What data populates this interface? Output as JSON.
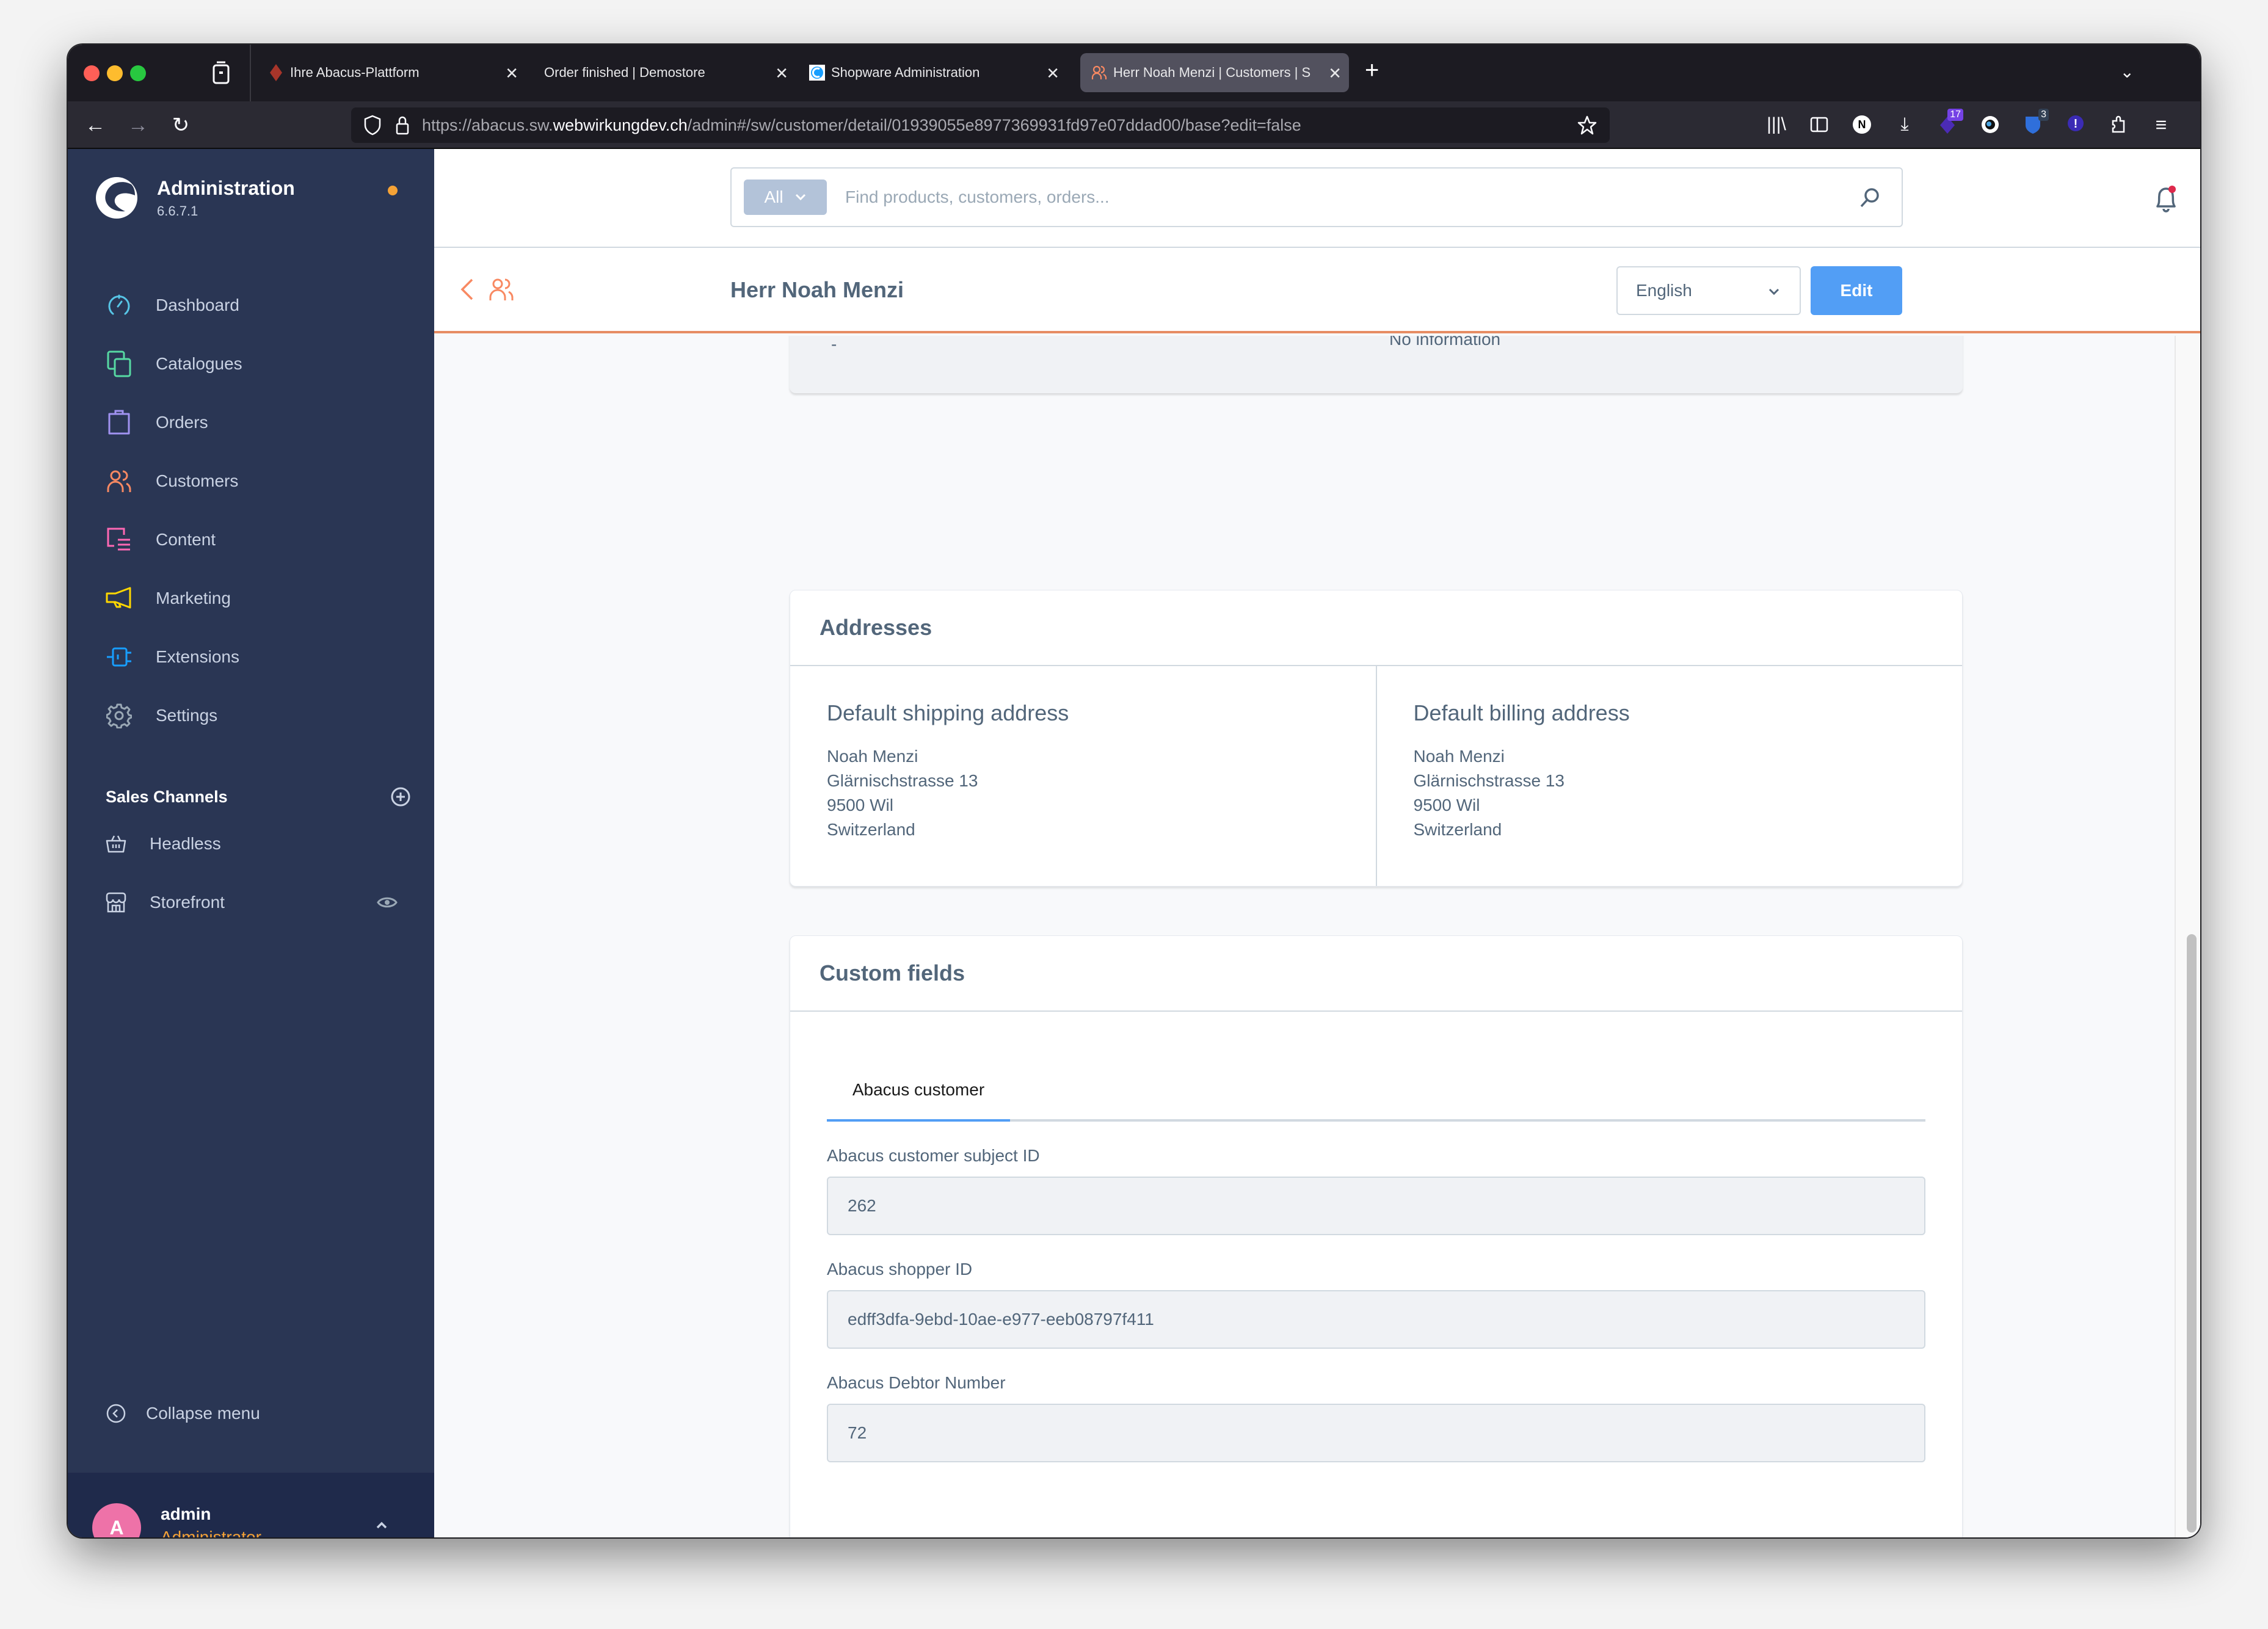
{
  "browser": {
    "tabs": [
      {
        "title": "Ihre Abacus-Plattform",
        "favicon": "abacus-diamond-icon",
        "active": false
      },
      {
        "title": "Order finished | Demostore",
        "favicon": "none",
        "active": false
      },
      {
        "title": "Shopware Administration",
        "favicon": "shopware-logo-icon",
        "active": false
      },
      {
        "title": "Herr Noah Menzi | Customers | S",
        "favicon": "customers-icon",
        "active": true
      }
    ],
    "url_prefix": "https://abacus.sw.",
    "url_domain": "webwirkungdev.ch",
    "url_path": "/admin#/sw/customer/detail/01939055e8977369931fd97e07ddad00/base?edit=false",
    "extension_badges": {
      "purple": "17",
      "blue": "3"
    }
  },
  "sidebar": {
    "brand_title": "Administration",
    "version": "6.6.7.1",
    "items": [
      {
        "label": "Dashboard",
        "icon": "dashboard-gauge-icon",
        "color": "#57c5e6"
      },
      {
        "label": "Catalogues",
        "icon": "catalogues-icon",
        "color": "#57d9a3"
      },
      {
        "label": "Orders",
        "icon": "orders-bag-icon",
        "color": "#a092f0"
      },
      {
        "label": "Customers",
        "icon": "customers-icon",
        "color": "#f88962"
      },
      {
        "label": "Content",
        "icon": "content-icon",
        "color": "#ff68b4"
      },
      {
        "label": "Marketing",
        "icon": "marketing-megaphone-icon",
        "color": "#ffd700"
      },
      {
        "label": "Extensions",
        "icon": "extensions-plug-icon",
        "color": "#189eff"
      },
      {
        "label": "Settings",
        "icon": "settings-gear-icon",
        "color": "#9aa8b5"
      }
    ],
    "sales_channels_title": "Sales Channels",
    "sales_channels": [
      {
        "label": "Headless",
        "icon": "basket-icon"
      },
      {
        "label": "Storefront",
        "icon": "storefront-icon"
      }
    ],
    "collapse_label": "Collapse menu",
    "user": {
      "initial": "A",
      "name": "admin",
      "role": "Administrator"
    }
  },
  "topbar": {
    "search_type": "All",
    "search_placeholder": "Find products, customers, orders..."
  },
  "page": {
    "title": "Herr Noah Menzi",
    "language": "English",
    "edit_label": "Edit"
  },
  "previous_card": {
    "left_value": "-",
    "right_value": "No information"
  },
  "addresses": {
    "title": "Addresses",
    "shipping": {
      "title": "Default shipping address",
      "lines": [
        "Noah Menzi",
        "Glärnischstrasse 13",
        "9500 Wil",
        "Switzerland"
      ]
    },
    "billing": {
      "title": "Default billing address",
      "lines": [
        "Noah Menzi",
        "Glärnischstrasse 13",
        "9500 Wil",
        "Switzerland"
      ]
    }
  },
  "custom_fields": {
    "title": "Custom fields",
    "tabs": [
      {
        "label": "Abacus customer",
        "active": true
      }
    ],
    "fields": [
      {
        "label": "Abacus customer subject ID",
        "value": "262"
      },
      {
        "label": "Abacus shopper ID",
        "value": "edff3dfa-9ebd-10ae-e977-eeb08797f411"
      },
      {
        "label": "Abacus Debtor Number",
        "value": "72"
      }
    ]
  }
}
